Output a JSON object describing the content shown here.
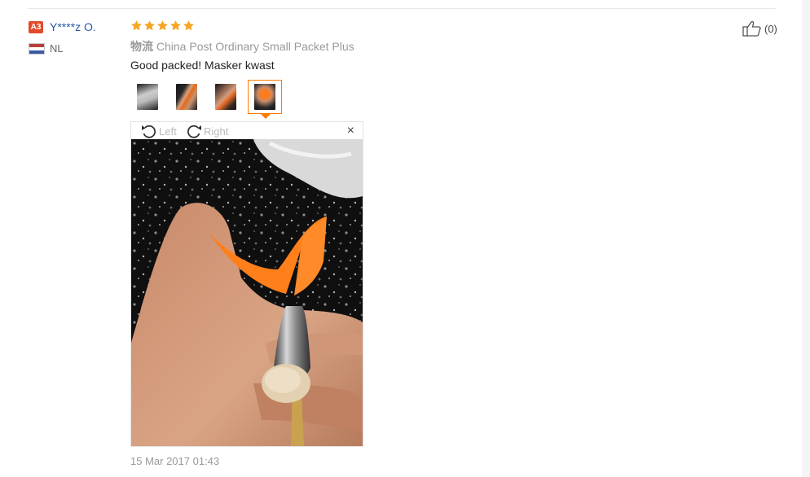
{
  "reviewer": {
    "level_badge": "A3",
    "name": "Y****z O.",
    "country": "NL"
  },
  "rating": {
    "stars": 5
  },
  "logistics": {
    "label": "物流",
    "carrier": "China Post Ordinary Small Packet Plus"
  },
  "review_text": "Good packed! Masker kwast",
  "thumbnails": [
    {
      "icon": "brush-photo-thumbnail-1",
      "active": false
    },
    {
      "icon": "brush-photo-thumbnail-2",
      "active": false
    },
    {
      "icon": "brush-photo-thumbnail-3",
      "active": false
    },
    {
      "icon": "brush-photo-thumbnail-4",
      "active": true
    }
  ],
  "viewer": {
    "rotate_left": "Left",
    "rotate_right": "Right",
    "close_symbol": "×"
  },
  "helpful": {
    "count": "(0)"
  },
  "datetime": "15 Mar 2017 01:43",
  "colors": {
    "star": "#f5a623",
    "accent": "#ff7a00",
    "link": "#2a5aa6",
    "badge": "#e04b2a"
  }
}
